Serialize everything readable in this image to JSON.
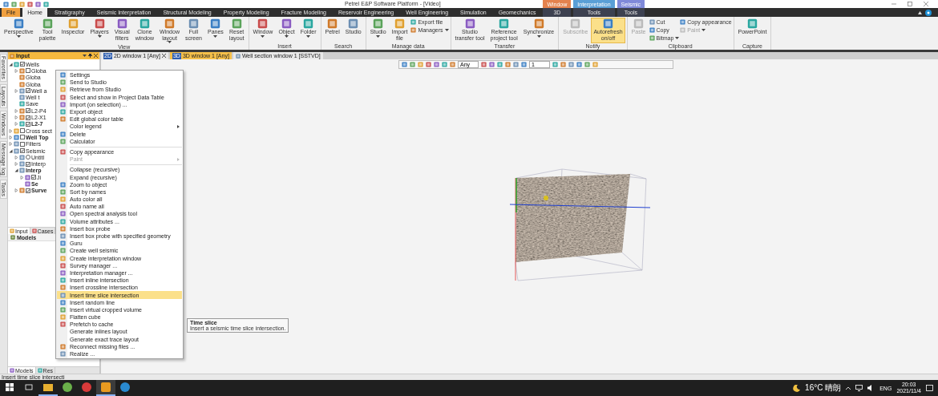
{
  "window": {
    "title": "Petrel E&P Software Platform - [Video]"
  },
  "ribbon_tabs": [
    {
      "label": "File",
      "kind": "file",
      "selected": false
    },
    {
      "label": "Home",
      "kind": "tab",
      "selected": true
    },
    {
      "label": "Stratigraphy",
      "kind": "tab",
      "selected": false
    },
    {
      "label": "Seismic Interpretation",
      "kind": "tab",
      "selected": false
    },
    {
      "label": "Structural Modeling",
      "kind": "tab",
      "selected": false
    },
    {
      "label": "Property Modeling",
      "kind": "tab",
      "selected": false
    },
    {
      "label": "Fracture Modeling",
      "kind": "tab",
      "selected": false
    },
    {
      "label": "Reservoir Engineering",
      "kind": "tab",
      "selected": false
    },
    {
      "label": "Well Engineering",
      "kind": "tab",
      "selected": false
    },
    {
      "label": "Simulation",
      "kind": "tab",
      "selected": false
    },
    {
      "label": "Geomechanics",
      "kind": "tab",
      "selected": false
    },
    {
      "label": "3D",
      "kind": "context",
      "context": "Window",
      "color": "#e4824e",
      "selected": false
    },
    {
      "label": "Tools",
      "kind": "context",
      "context": "Interpretation",
      "color": "#5a9fd6",
      "selected": false
    },
    {
      "label": "Tools",
      "kind": "context",
      "context": "Seismic",
      "color": "#7f89d9",
      "selected": false
    }
  ],
  "ribbon_groups": [
    {
      "label": "View",
      "items": [
        {
          "kind": "large",
          "label": "Perspective",
          "dropdown": true,
          "disabled": false,
          "on": false
        },
        {
          "kind": "large",
          "label": "Tool\npalette",
          "dropdown": false,
          "disabled": false,
          "on": false
        },
        {
          "kind": "large",
          "label": "Inspector",
          "dropdown": false,
          "disabled": false,
          "on": false
        },
        {
          "kind": "large",
          "label": "Players",
          "dropdown": true,
          "disabled": false,
          "on": false
        },
        {
          "kind": "large",
          "label": "Visual\nfilters",
          "dropdown": false,
          "disabled": false,
          "on": false
        },
        {
          "kind": "large",
          "label": "Clone\nwindow",
          "dropdown": false,
          "disabled": false,
          "on": false
        },
        {
          "kind": "large",
          "label": "Window\nlayout",
          "dropdown": true,
          "disabled": false,
          "on": false
        },
        {
          "kind": "large",
          "label": "Full\nscreen",
          "dropdown": false,
          "disabled": false,
          "on": false
        },
        {
          "kind": "large",
          "label": "Panes",
          "dropdown": true,
          "disabled": false,
          "on": false
        },
        {
          "kind": "large",
          "label": "Reset\nlayout",
          "dropdown": false,
          "disabled": false,
          "on": false
        }
      ]
    },
    {
      "label": "Insert",
      "items": [
        {
          "kind": "large",
          "label": "Window",
          "dropdown": true,
          "disabled": false,
          "on": false
        },
        {
          "kind": "large",
          "label": "Object",
          "dropdown": true,
          "disabled": false,
          "on": false
        },
        {
          "kind": "large",
          "label": "Folder",
          "dropdown": true,
          "disabled": false,
          "on": false
        }
      ]
    },
    {
      "label": "Search",
      "items": [
        {
          "kind": "large",
          "label": "Petrel",
          "dropdown": false,
          "disabled": false,
          "on": false
        },
        {
          "kind": "large",
          "label": "Studio",
          "dropdown": false,
          "disabled": false,
          "on": false
        }
      ]
    },
    {
      "label": "Manage data",
      "items": [
        {
          "kind": "large",
          "label": "Studio",
          "dropdown": true,
          "disabled": false,
          "on": false
        },
        {
          "kind": "large",
          "label": "Import\nfile",
          "dropdown": false,
          "disabled": false,
          "on": false
        },
        {
          "kind": "stack",
          "buttons": [
            {
              "label": "Export file",
              "dropdown": false,
              "disabled": false
            },
            {
              "label": "Managers",
              "dropdown": true,
              "disabled": false
            }
          ]
        }
      ]
    },
    {
      "label": "Transfer",
      "items": [
        {
          "kind": "large",
          "label": "Studio\ntransfer tool",
          "dropdown": false,
          "disabled": false,
          "on": false
        },
        {
          "kind": "large",
          "label": "Reference\nproject tool",
          "dropdown": false,
          "disabled": false,
          "on": false
        },
        {
          "kind": "large",
          "label": "Synchronize",
          "dropdown": true,
          "disabled": false,
          "on": false
        }
      ]
    },
    {
      "label": "Notify",
      "items": [
        {
          "kind": "large",
          "label": "Subscribe",
          "dropdown": false,
          "disabled": true,
          "on": false
        },
        {
          "kind": "large",
          "label": "Autorefresh\non/off",
          "dropdown": false,
          "disabled": false,
          "on": true
        }
      ]
    },
    {
      "label": "Clipboard",
      "items": [
        {
          "kind": "large",
          "label": "Paste",
          "dropdown": false,
          "disabled": true,
          "on": false
        },
        {
          "kind": "stack",
          "buttons": [
            {
              "label": "Cut",
              "dropdown": false,
              "disabled": false
            },
            {
              "label": "Copy",
              "dropdown": false,
              "disabled": false
            },
            {
              "label": "Bitmap",
              "dropdown": true,
              "disabled": false
            }
          ]
        },
        {
          "kind": "stack",
          "buttons": [
            {
              "label": "Copy appearance",
              "dropdown": false,
              "disabled": false
            },
            {
              "label": "Paint",
              "dropdown": true,
              "disabled": true
            }
          ]
        }
      ]
    },
    {
      "label": "Capture",
      "items": [
        {
          "kind": "large",
          "label": "PowerPoint",
          "dropdown": false,
          "disabled": false,
          "on": false
        }
      ]
    }
  ],
  "side_tabs": [
    "Favorites",
    "Layouts",
    "Windows",
    "Message log",
    "Tasks"
  ],
  "input_panel": {
    "title": "Input",
    "tree": [
      {
        "label": "Wells",
        "kind": "check",
        "checked": true,
        "expanded": true,
        "bold": false,
        "children": [
          {
            "label": "Globa",
            "kind": "check",
            "checked": false,
            "expanded": false,
            "bold": false
          },
          {
            "label": "Globa",
            "kind": "plain",
            "bold": false
          },
          {
            "label": "Globa",
            "kind": "plain",
            "bold": false
          },
          {
            "label": "Well a",
            "kind": "check",
            "checked": true,
            "expanded": false,
            "bold": false
          },
          {
            "label": "Well t",
            "kind": "plain",
            "bold": false
          },
          {
            "label": "Save",
            "kind": "plain",
            "bold": false
          },
          {
            "label": "L2-P4",
            "kind": "check",
            "checked": true,
            "expanded": false,
            "bold": false
          },
          {
            "label": "L2-X1",
            "kind": "check",
            "checked": true,
            "expanded": false,
            "bold": false
          },
          {
            "label": "L2-7",
            "kind": "check",
            "checked": true,
            "expanded": false,
            "bold": true
          }
        ]
      },
      {
        "label": "Cross sect",
        "kind": "check",
        "checked": false,
        "expanded": false,
        "bold": false
      },
      {
        "label": "Well Top",
        "kind": "check",
        "checked": false,
        "expanded": false,
        "bold": true
      },
      {
        "label": "Filters",
        "kind": "check",
        "checked": false,
        "expanded": false,
        "bold": false
      },
      {
        "label": "Seismic",
        "kind": "check",
        "checked": true,
        "expanded": true,
        "bold": false,
        "children": [
          {
            "label": "Untitl",
            "kind": "radio",
            "checked": false,
            "expanded": false,
            "bold": false
          },
          {
            "label": "Interp",
            "kind": "check",
            "checked": true,
            "expanded": false,
            "bold": false
          },
          {
            "label": "Interp",
            "kind": "plain",
            "expanded": true,
            "bold": true,
            "children": [
              {
                "label": "Ji",
                "kind": "check",
                "checked": true,
                "expanded": false,
                "bold": false
              },
              {
                "label": "Se",
                "kind": "plain",
                "bold": true
              }
            ]
          },
          {
            "label": "Surve",
            "kind": "check",
            "checked": true,
            "expanded": false,
            "bold": true
          }
        ]
      }
    ]
  },
  "panel_tabs": [
    {
      "label": "Input",
      "selected": true
    },
    {
      "label": "Cases",
      "selected": false
    }
  ],
  "models_panel": {
    "title": "Models"
  },
  "bottom_tabs": [
    {
      "label": "Models",
      "selected": true
    },
    {
      "label": "Res",
      "selected": false
    }
  ],
  "window_tabs": [
    {
      "badge": "2D",
      "label": "2D window 1 [Any]",
      "selected": false,
      "closable": true
    },
    {
      "badge": "3D",
      "label": "3D window 1 [Any]",
      "selected": true,
      "closable": false
    },
    {
      "label": "Well section window 1 [SSTVD]",
      "selected": false,
      "closable": false
    }
  ],
  "view_toolbar": {
    "combos": [
      "Any",
      "1"
    ]
  },
  "context_menu": {
    "items": [
      {
        "kind": "item",
        "label": "Settings",
        "icon": true,
        "submenu": false,
        "disabled": false,
        "selected": false
      },
      {
        "kind": "item",
        "label": "Send to Studio",
        "icon": true,
        "submenu": false,
        "disabled": false,
        "selected": false
      },
      {
        "kind": "item",
        "label": "Retrieve from Studio",
        "icon": true,
        "submenu": false,
        "disabled": false,
        "selected": false
      },
      {
        "kind": "item",
        "label": "Select and show in Project Data Table",
        "icon": true,
        "submenu": false,
        "disabled": false,
        "selected": false
      },
      {
        "kind": "item",
        "label": "Import (on selection) ...",
        "icon": true,
        "submenu": false,
        "disabled": false,
        "selected": false
      },
      {
        "kind": "item",
        "label": "Export object",
        "icon": true,
        "submenu": false,
        "disabled": false,
        "selected": false
      },
      {
        "kind": "item",
        "label": "Edit global color table",
        "icon": true,
        "submenu": false,
        "disabled": false,
        "selected": false
      },
      {
        "kind": "item",
        "label": "Color legend",
        "icon": false,
        "submenu": true,
        "disabled": false,
        "selected": false
      },
      {
        "kind": "item",
        "label": "Delete",
        "icon": true,
        "submenu": false,
        "disabled": false,
        "selected": false
      },
      {
        "kind": "item",
        "label": "Calculator",
        "icon": true,
        "submenu": false,
        "disabled": false,
        "selected": false
      },
      {
        "kind": "separator"
      },
      {
        "kind": "item",
        "label": "Copy appearance",
        "icon": true,
        "submenu": false,
        "disabled": false,
        "selected": false
      },
      {
        "kind": "item",
        "label": "Paint",
        "icon": false,
        "submenu": true,
        "disabled": true,
        "selected": false
      },
      {
        "kind": "separator"
      },
      {
        "kind": "item",
        "label": "Collapse (recursive)",
        "icon": false,
        "submenu": false,
        "disabled": false,
        "selected": false
      },
      {
        "kind": "item",
        "label": "Expand (recursive)",
        "icon": false,
        "submenu": false,
        "disabled": false,
        "selected": false
      },
      {
        "kind": "item",
        "label": "Zoom to object",
        "icon": true,
        "submenu": false,
        "disabled": false,
        "selected": false
      },
      {
        "kind": "item",
        "label": "Sort by names",
        "icon": true,
        "submenu": false,
        "disabled": false,
        "selected": false
      },
      {
        "kind": "item",
        "label": "Auto color all",
        "icon": true,
        "submenu": false,
        "disabled": false,
        "selected": false
      },
      {
        "kind": "item",
        "label": "Auto name all",
        "icon": true,
        "submenu": false,
        "disabled": false,
        "selected": false
      },
      {
        "kind": "item",
        "label": "Open spectral analysis tool",
        "icon": true,
        "submenu": false,
        "disabled": false,
        "selected": false
      },
      {
        "kind": "item",
        "label": "Volume attributes ...",
        "icon": true,
        "submenu": false,
        "disabled": false,
        "selected": false
      },
      {
        "kind": "item",
        "label": "Insert box probe",
        "icon": true,
        "submenu": false,
        "disabled": false,
        "selected": false
      },
      {
        "kind": "item",
        "label": "Insert box probe with specified geometry",
        "icon": true,
        "submenu": false,
        "disabled": false,
        "selected": false
      },
      {
        "kind": "item",
        "label": "Guru",
        "icon": true,
        "submenu": false,
        "disabled": false,
        "selected": false
      },
      {
        "kind": "item",
        "label": "Create well seismic",
        "icon": true,
        "submenu": false,
        "disabled": false,
        "selected": false
      },
      {
        "kind": "item",
        "label": "Create interpretation window",
        "icon": true,
        "submenu": false,
        "disabled": false,
        "selected": false
      },
      {
        "kind": "item",
        "label": "Survey manager ...",
        "icon": true,
        "submenu": false,
        "disabled": false,
        "selected": false
      },
      {
        "kind": "item",
        "label": "Interpretation manager ...",
        "icon": true,
        "submenu": false,
        "disabled": false,
        "selected": false
      },
      {
        "kind": "item",
        "label": "Insert inline intersection",
        "icon": true,
        "submenu": false,
        "disabled": false,
        "selected": false
      },
      {
        "kind": "item",
        "label": "Insert crossline intersection",
        "icon": true,
        "submenu": false,
        "disabled": false,
        "selected": false
      },
      {
        "kind": "item",
        "label": "Insert time slice intersection",
        "icon": true,
        "submenu": false,
        "disabled": false,
        "selected": true
      },
      {
        "kind": "item",
        "label": "Insert random line",
        "icon": true,
        "submenu": false,
        "disabled": false,
        "selected": false
      },
      {
        "kind": "item",
        "label": "Insert virtual cropped volume",
        "icon": true,
        "submenu": false,
        "disabled": false,
        "selected": false
      },
      {
        "kind": "item",
        "label": "Flatten cube",
        "icon": true,
        "submenu": false,
        "disabled": false,
        "selected": false
      },
      {
        "kind": "item",
        "label": "Prefetch to cache",
        "icon": true,
        "submenu": false,
        "disabled": false,
        "selected": false
      },
      {
        "kind": "item",
        "label": "Generate inlines layout",
        "icon": false,
        "submenu": false,
        "disabled": false,
        "selected": false
      },
      {
        "kind": "item",
        "label": "Generate exact trace layout",
        "icon": false,
        "submenu": false,
        "disabled": false,
        "selected": false
      },
      {
        "kind": "item",
        "label": "Reconnect missing files ...",
        "icon": true,
        "submenu": false,
        "disabled": false,
        "selected": false
      },
      {
        "kind": "item",
        "label": "Realize ...",
        "icon": true,
        "submenu": false,
        "disabled": false,
        "selected": false
      }
    ]
  },
  "tooltip": {
    "title": "Time slice",
    "text": "Insert a seismic time slice intersection."
  },
  "status_bar": {
    "text": "Insert time slice intersecti"
  },
  "taskbar": {
    "apps": [
      {
        "running": true,
        "selected": false
      },
      {
        "running": false,
        "selected": false
      },
      {
        "running": false,
        "selected": false
      },
      {
        "running": true,
        "selected": true
      },
      {
        "running": false,
        "selected": false
      }
    ],
    "weather": "16°C 晴朗",
    "language": "ENG",
    "time": "20:03",
    "date": "2021/11/4"
  }
}
